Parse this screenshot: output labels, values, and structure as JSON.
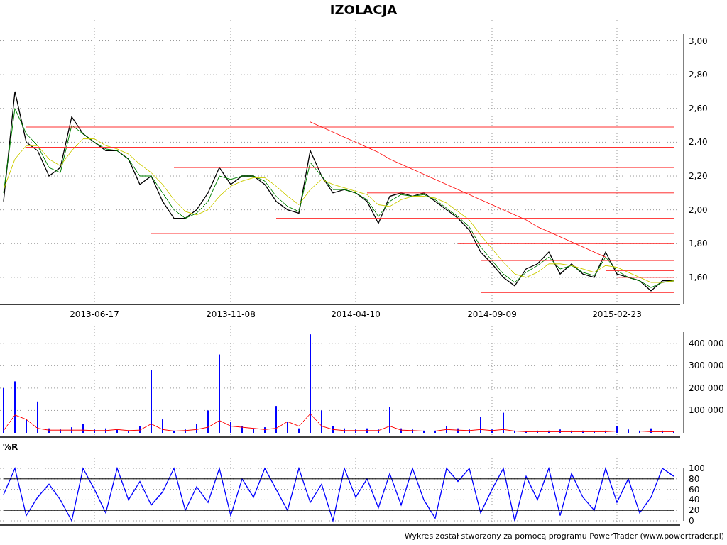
{
  "title": "IZOLACJA",
  "price": {
    "chart_data": {
      "type": "line",
      "grid": true,
      "categories": [
        null,
        null,
        null,
        null,
        null,
        null,
        null,
        null,
        "2013-06-17",
        null,
        null,
        null,
        null,
        null,
        null,
        null,
        null,
        null,
        null,
        null,
        "2013-11-08",
        null,
        null,
        null,
        null,
        null,
        null,
        null,
        null,
        null,
        null,
        "2014-04-10",
        null,
        null,
        null,
        null,
        null,
        null,
        null,
        null,
        null,
        null,
        null,
        "2014-09-09",
        null,
        null,
        null,
        null,
        null,
        null,
        null,
        null,
        null,
        null,
        "2015-02-23",
        null,
        null,
        null,
        null,
        null
      ],
      "series": [
        {
          "color": "#000000",
          "values": [
            2.05,
            2.7,
            2.4,
            2.35,
            2.2,
            2.25,
            2.55,
            2.45,
            2.4,
            2.35,
            2.35,
            2.3,
            2.15,
            2.2,
            2.05,
            1.95,
            1.95,
            2.0,
            2.1,
            2.25,
            2.15,
            2.2,
            2.2,
            2.15,
            2.05,
            2.0,
            1.98,
            2.35,
            2.2,
            2.1,
            2.12,
            2.1,
            2.05,
            1.92,
            2.08,
            2.1,
            2.08,
            2.1,
            2.05,
            2.0,
            1.95,
            1.88,
            1.75,
            1.68,
            1.6,
            1.55,
            1.65,
            1.68,
            1.75,
            1.62,
            1.68,
            1.62,
            1.6,
            1.75,
            1.62,
            1.6,
            1.58,
            1.52,
            1.58,
            1.58
          ]
        },
        {
          "color": "#008000",
          "values": [
            2.1,
            2.6,
            2.45,
            2.38,
            2.25,
            2.22,
            2.5,
            2.45,
            2.4,
            2.36,
            2.35,
            2.3,
            2.2,
            2.2,
            2.1,
            2.0,
            1.95,
            1.98,
            2.05,
            2.2,
            2.18,
            2.2,
            2.2,
            2.17,
            2.08,
            2.02,
            1.99,
            2.28,
            2.2,
            2.12,
            2.12,
            2.1,
            2.06,
            1.96,
            2.05,
            2.09,
            2.08,
            2.09,
            2.06,
            2.01,
            1.96,
            1.9,
            1.78,
            1.7,
            1.62,
            1.57,
            1.63,
            1.67,
            1.72,
            1.65,
            1.67,
            1.63,
            1.61,
            1.72,
            1.64,
            1.6,
            1.58,
            1.54,
            1.57,
            1.58
          ]
        },
        {
          "color": "#cccc00",
          "values": [
            2.12,
            2.3,
            2.38,
            2.38,
            2.3,
            2.26,
            2.35,
            2.42,
            2.42,
            2.38,
            2.36,
            2.33,
            2.27,
            2.22,
            2.15,
            2.06,
            1.99,
            1.97,
            2.0,
            2.08,
            2.14,
            2.17,
            2.19,
            2.19,
            2.14,
            2.08,
            2.03,
            2.12,
            2.18,
            2.15,
            2.13,
            2.11,
            2.09,
            2.03,
            2.02,
            2.06,
            2.08,
            2.08,
            2.07,
            2.04,
            1.99,
            1.94,
            1.85,
            1.77,
            1.69,
            1.62,
            1.6,
            1.63,
            1.68,
            1.68,
            1.67,
            1.65,
            1.63,
            1.67,
            1.66,
            1.63,
            1.6,
            1.57,
            1.57,
            1.58
          ]
        },
        {
          "color": "#ff3030",
          "values": [
            null,
            null,
            2.49,
            2.49,
            2.49,
            2.49,
            2.49,
            2.49,
            2.49,
            2.49,
            2.49,
            2.49,
            2.49,
            2.49,
            2.49,
            2.49,
            2.49,
            2.49,
            2.49,
            2.49,
            2.49,
            2.49,
            2.49,
            2.49,
            2.49,
            2.49,
            2.49,
            2.49,
            2.49,
            2.49,
            2.49,
            2.49,
            2.49,
            2.49,
            2.49,
            2.49,
            2.49,
            2.49,
            2.49,
            2.49,
            2.49,
            2.49,
            2.49,
            2.49,
            2.49,
            2.49,
            2.49,
            2.49,
            2.49,
            2.49,
            2.49,
            2.49,
            2.49,
            2.49,
            2.49,
            2.49,
            2.49,
            2.49,
            2.49,
            2.49
          ]
        },
        {
          "color": "#ff3030",
          "values": [
            null,
            null,
            2.37,
            2.37,
            2.37,
            2.37,
            2.37,
            2.37,
            2.37,
            2.37,
            2.37,
            2.37,
            2.37,
            2.37,
            2.37,
            2.37,
            2.37,
            2.37,
            2.37,
            2.37,
            2.37,
            2.37,
            2.37,
            2.37,
            2.37,
            2.37,
            2.37,
            2.37,
            2.37,
            2.37,
            2.37,
            2.37,
            2.37,
            2.37,
            2.37,
            2.37,
            2.37,
            2.37,
            2.37,
            2.37,
            2.37,
            2.37,
            2.37,
            2.37,
            2.37,
            2.37,
            2.37,
            2.37,
            2.37,
            2.37,
            2.37,
            2.37,
            2.37,
            2.37,
            2.37,
            2.37,
            2.37,
            2.37,
            2.37,
            2.37
          ]
        },
        {
          "color": "#ff3030",
          "values": [
            null,
            null,
            null,
            null,
            null,
            null,
            null,
            null,
            null,
            null,
            null,
            null,
            null,
            null,
            null,
            2.25,
            2.25,
            2.25,
            2.25,
            2.25,
            2.25,
            2.25,
            2.25,
            2.25,
            2.25,
            2.25,
            2.25,
            2.25,
            2.25,
            2.25,
            2.25,
            2.25,
            2.25,
            2.25,
            2.25,
            2.25,
            2.25,
            2.25,
            2.25,
            2.25,
            2.25,
            2.25,
            2.25,
            2.25,
            2.25,
            2.25,
            2.25,
            2.25,
            2.25,
            2.25,
            2.25,
            2.25,
            2.25,
            2.25,
            2.25,
            2.25,
            2.25,
            2.25,
            2.25,
            2.25
          ]
        },
        {
          "color": "#ff3030",
          "values": [
            null,
            null,
            null,
            null,
            null,
            null,
            null,
            null,
            null,
            null,
            null,
            null,
            null,
            null,
            null,
            null,
            null,
            null,
            null,
            null,
            null,
            null,
            null,
            null,
            null,
            null,
            null,
            null,
            null,
            null,
            null,
            null,
            2.1,
            2.1,
            2.1,
            2.1,
            2.1,
            2.1,
            2.1,
            2.1,
            2.1,
            2.1,
            2.1,
            2.1,
            2.1,
            2.1,
            2.1,
            2.1,
            2.1,
            2.1,
            2.1,
            2.1,
            2.1,
            2.1,
            2.1,
            2.1,
            2.1,
            2.1,
            2.1,
            2.1
          ]
        },
        {
          "color": "#ff3030",
          "values": [
            null,
            null,
            null,
            null,
            null,
            null,
            null,
            null,
            null,
            null,
            null,
            null,
            null,
            null,
            null,
            null,
            null,
            null,
            null,
            null,
            null,
            null,
            null,
            null,
            1.95,
            1.95,
            1.95,
            1.95,
            1.95,
            1.95,
            1.95,
            1.95,
            1.95,
            1.95,
            1.95,
            1.95,
            1.95,
            1.95,
            1.95,
            1.95,
            1.95,
            1.95,
            1.95,
            1.95,
            1.95,
            1.95,
            1.95,
            1.95,
            1.95,
            1.95,
            1.95,
            1.95,
            1.95,
            1.95,
            1.95,
            1.95,
            1.95,
            1.95,
            1.95,
            1.95
          ]
        },
        {
          "color": "#ff3030",
          "values": [
            null,
            null,
            null,
            null,
            null,
            null,
            null,
            null,
            null,
            null,
            null,
            null,
            null,
            1.86,
            1.86,
            1.86,
            1.86,
            1.86,
            1.86,
            1.86,
            1.86,
            1.86,
            1.86,
            1.86,
            1.86,
            1.86,
            1.86,
            1.86,
            1.86,
            1.86,
            1.86,
            1.86,
            1.86,
            1.86,
            1.86,
            1.86,
            1.86,
            1.86,
            1.86,
            1.86,
            1.86,
            1.86,
            1.86,
            1.86,
            1.86,
            1.86,
            1.86,
            1.86,
            1.86,
            1.86,
            1.86,
            1.86,
            1.86,
            1.86,
            1.86,
            1.86,
            1.86,
            1.86,
            1.86,
            1.86
          ]
        },
        {
          "color": "#ff3030",
          "values": [
            null,
            null,
            null,
            null,
            null,
            null,
            null,
            null,
            null,
            null,
            null,
            null,
            null,
            null,
            null,
            null,
            null,
            null,
            null,
            null,
            null,
            null,
            null,
            null,
            null,
            null,
            null,
            null,
            null,
            null,
            null,
            null,
            null,
            null,
            null,
            null,
            null,
            null,
            null,
            null,
            1.8,
            1.8,
            1.8,
            1.8,
            1.8,
            1.8,
            1.8,
            1.8,
            1.8,
            1.8,
            1.8,
            1.8,
            1.8,
            1.8,
            1.8,
            1.8,
            1.8,
            1.8,
            1.8,
            1.8
          ]
        },
        {
          "color": "#ff3030",
          "values": [
            null,
            null,
            null,
            null,
            null,
            null,
            null,
            null,
            null,
            null,
            null,
            null,
            null,
            null,
            null,
            null,
            null,
            null,
            null,
            null,
            null,
            null,
            null,
            null,
            null,
            null,
            null,
            null,
            null,
            null,
            null,
            null,
            null,
            null,
            null,
            null,
            null,
            null,
            null,
            null,
            null,
            null,
            1.7,
            1.7,
            1.7,
            1.7,
            1.7,
            1.7,
            1.7,
            1.7,
            1.7,
            1.7,
            1.7,
            1.7,
            1.7,
            1.7,
            1.7,
            1.7,
            1.7,
            1.7
          ]
        },
        {
          "color": "#ff3030",
          "values": [
            null,
            null,
            null,
            null,
            null,
            null,
            null,
            null,
            null,
            null,
            null,
            null,
            null,
            null,
            null,
            null,
            null,
            null,
            null,
            null,
            null,
            null,
            null,
            null,
            null,
            null,
            null,
            null,
            null,
            null,
            null,
            null,
            null,
            null,
            null,
            null,
            null,
            null,
            null,
            null,
            null,
            null,
            null,
            null,
            null,
            null,
            null,
            null,
            null,
            null,
            null,
            null,
            null,
            1.64,
            1.64,
            1.64,
            1.64,
            1.64,
            1.64,
            1.64
          ]
        },
        {
          "color": "#ff3030",
          "values": [
            null,
            null,
            null,
            null,
            null,
            null,
            null,
            null,
            null,
            null,
            null,
            null,
            null,
            null,
            null,
            null,
            null,
            null,
            null,
            null,
            null,
            null,
            null,
            null,
            null,
            null,
            null,
            null,
            null,
            null,
            null,
            null,
            null,
            null,
            null,
            null,
            null,
            null,
            null,
            null,
            null,
            null,
            null,
            null,
            null,
            null,
            null,
            null,
            null,
            null,
            null,
            null,
            null,
            null,
            1.6,
            1.6,
            1.6,
            1.6,
            1.6,
            1.6
          ]
        },
        {
          "color": "#ff3030",
          "values": [
            null,
            null,
            null,
            null,
            null,
            null,
            null,
            null,
            null,
            null,
            null,
            null,
            null,
            null,
            null,
            null,
            null,
            null,
            null,
            null,
            null,
            null,
            null,
            null,
            null,
            null,
            null,
            null,
            null,
            null,
            null,
            null,
            null,
            null,
            null,
            null,
            null,
            null,
            null,
            null,
            null,
            null,
            1.51,
            1.51,
            1.51,
            1.51,
            1.51,
            1.51,
            1.51,
            1.51,
            1.51,
            1.51,
            1.51,
            1.51,
            1.51,
            1.51,
            1.51,
            1.51,
            1.51,
            1.51
          ]
        },
        {
          "color": "#ff2020",
          "values": [
            null,
            null,
            null,
            null,
            null,
            null,
            null,
            null,
            null,
            null,
            null,
            null,
            null,
            null,
            null,
            null,
            null,
            null,
            null,
            null,
            null,
            null,
            null,
            null,
            null,
            null,
            null,
            2.52,
            2.49,
            2.46,
            2.43,
            2.4,
            2.37,
            2.34,
            2.3,
            2.27,
            2.24,
            2.21,
            2.18,
            2.15,
            2.12,
            2.09,
            2.06,
            2.03,
            2.0,
            1.97,
            1.94,
            1.9,
            1.87,
            1.84,
            1.81,
            1.78,
            1.75,
            1.72,
            null,
            null,
            null,
            null,
            null,
            null
          ]
        }
      ],
      "ylim": [
        1.44,
        3.04
      ],
      "yticks": [
        {
          "value": 1.6,
          "label": "1,60"
        },
        {
          "value": 1.8,
          "label": "1,80"
        },
        {
          "value": 2.0,
          "label": "2,00"
        },
        {
          "value": 2.2,
          "label": "2,20"
        },
        {
          "value": 2.4,
          "label": "2,40"
        },
        {
          "value": 2.6,
          "label": "2,60"
        },
        {
          "value": 2.8,
          "label": "2,80"
        },
        {
          "value": 3.0,
          "label": "3,00"
        }
      ]
    }
  },
  "volume": {
    "chart_data": {
      "type": "bar",
      "grid": true,
      "series": [
        {
          "color": "#0000ff",
          "values": [
            200000,
            230000,
            60000,
            140000,
            20000,
            15000,
            25000,
            40000,
            15000,
            20000,
            15000,
            10000,
            30000,
            280000,
            60000,
            10000,
            15000,
            40000,
            100000,
            350000,
            50000,
            30000,
            20000,
            25000,
            120000,
            50000,
            20000,
            440000,
            100000,
            30000,
            20000,
            15000,
            20000,
            15000,
            115000,
            20000,
            15000,
            10000,
            10000,
            30000,
            20000,
            15000,
            70000,
            15000,
            90000,
            10000,
            8000,
            10000,
            10000,
            15000,
            10000,
            10000,
            8000,
            10000,
            30000,
            15000,
            10000,
            20000,
            10000,
            8000
          ]
        },
        {
          "type": "line",
          "color": "#ff0000",
          "values": [
            10000,
            80000,
            60000,
            20000,
            12000,
            12000,
            12000,
            12000,
            10000,
            10000,
            15000,
            10000,
            12000,
            40000,
            15000,
            8000,
            10000,
            15000,
            25000,
            55000,
            30000,
            25000,
            20000,
            15000,
            20000,
            50000,
            30000,
            85000,
            30000,
            15000,
            10000,
            10000,
            10000,
            10000,
            30000,
            12000,
            10000,
            8000,
            8000,
            15000,
            12000,
            10000,
            15000,
            10000,
            15000,
            8000,
            5000,
            5000,
            5000,
            5000,
            5000,
            5000,
            5000,
            5000,
            8000,
            8000,
            8000,
            5000,
            5000,
            5000
          ]
        }
      ],
      "ylim": [
        0,
        450000
      ],
      "yticks": [
        {
          "value": 100000,
          "label": "100 000"
        },
        {
          "value": 200000,
          "label": "200 000"
        },
        {
          "value": 300000,
          "label": "300 000"
        },
        {
          "value": 400000,
          "label": "400 000"
        }
      ]
    }
  },
  "williams": {
    "chart_data": {
      "type": "line",
      "title": "%R",
      "grid": true,
      "series": [
        {
          "color": "#0000ff",
          "values": [
            50,
            100,
            10,
            45,
            70,
            40,
            0,
            100,
            60,
            15,
            100,
            40,
            75,
            30,
            55,
            100,
            20,
            65,
            35,
            100,
            10,
            80,
            45,
            100,
            60,
            20,
            100,
            35,
            70,
            0,
            100,
            45,
            80,
            25,
            90,
            30,
            100,
            40,
            5,
            100,
            75,
            100,
            15,
            60,
            100,
            0,
            85,
            40,
            100,
            10,
            90,
            45,
            20,
            100,
            35,
            80,
            15,
            45,
            100,
            85
          ]
        },
        {
          "color": "#000000",
          "values": [
            80,
            80,
            80,
            80,
            80,
            80,
            80,
            80,
            80,
            80,
            80,
            80,
            80,
            80,
            80,
            80,
            80,
            80,
            80,
            80,
            80,
            80,
            80,
            80,
            80,
            80,
            80,
            80,
            80,
            80,
            80,
            80,
            80,
            80,
            80,
            80,
            80,
            80,
            80,
            80,
            80,
            80,
            80,
            80,
            80,
            80,
            80,
            80,
            80,
            80,
            80,
            80,
            80,
            80,
            80,
            80,
            80,
            80,
            80,
            80
          ]
        },
        {
          "color": "#000000",
          "values": [
            20,
            20,
            20,
            20,
            20,
            20,
            20,
            20,
            20,
            20,
            20,
            20,
            20,
            20,
            20,
            20,
            20,
            20,
            20,
            20,
            20,
            20,
            20,
            20,
            20,
            20,
            20,
            20,
            20,
            20,
            20,
            20,
            20,
            20,
            20,
            20,
            20,
            20,
            20,
            20,
            20,
            20,
            20,
            20,
            20,
            20,
            20,
            20,
            20,
            20,
            20,
            20,
            20,
            20,
            20,
            20,
            20,
            20,
            20,
            20
          ]
        }
      ],
      "ylim": [
        0,
        100
      ],
      "yticks": [
        0,
        20,
        40,
        60,
        80,
        100
      ]
    }
  },
  "footer": "Wykres został stworzony za pomocą programu PowerTrader (www.powertrader.pl)"
}
